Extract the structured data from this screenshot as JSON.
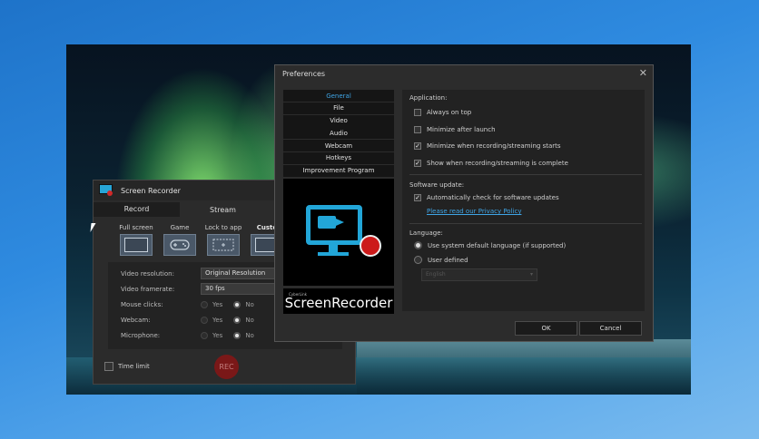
{
  "recorder": {
    "title": "Screen Recorder",
    "tabs": [
      "Record",
      "Stream"
    ],
    "modes": [
      "Full screen",
      "Game",
      "Lock to app",
      "Custo"
    ],
    "settings": {
      "resolution_label": "Video resolution:",
      "resolution_value": "Original Resolution",
      "framerate_label": "Video framerate:",
      "framerate_value": "30 fps",
      "mouse_label": "Mouse clicks:",
      "webcam_label": "Webcam:",
      "mic_label": "Microphone:",
      "yes": "Yes",
      "no": "No"
    },
    "time_limit": "Time limit",
    "rec_label": "REC"
  },
  "preferences": {
    "title": "Preferences",
    "close_glyph": "✕",
    "nav": [
      "General",
      "File",
      "Video",
      "Audio",
      "Webcam",
      "Hotkeys",
      "Improvement Program"
    ],
    "brand_small": "CyberLink",
    "brand": "ScreenRecorder",
    "application": {
      "heading": "Application:",
      "options": [
        {
          "label": "Always on top",
          "checked": false
        },
        {
          "label": "Minimize after launch",
          "checked": false
        },
        {
          "label": "Minimize when recording/streaming starts",
          "checked": true
        },
        {
          "label": "Show when recording/streaming is complete",
          "checked": true
        }
      ]
    },
    "software_update": {
      "heading": "Software update:",
      "auto_check": "Automatically check for software updates",
      "privacy_link": "Please read our Privacy Policy"
    },
    "language": {
      "heading": "Language:",
      "system_default": "Use system default language (if supported)",
      "user_defined": "User defined",
      "select_value": "English"
    },
    "ok": "OK",
    "cancel": "Cancel"
  }
}
